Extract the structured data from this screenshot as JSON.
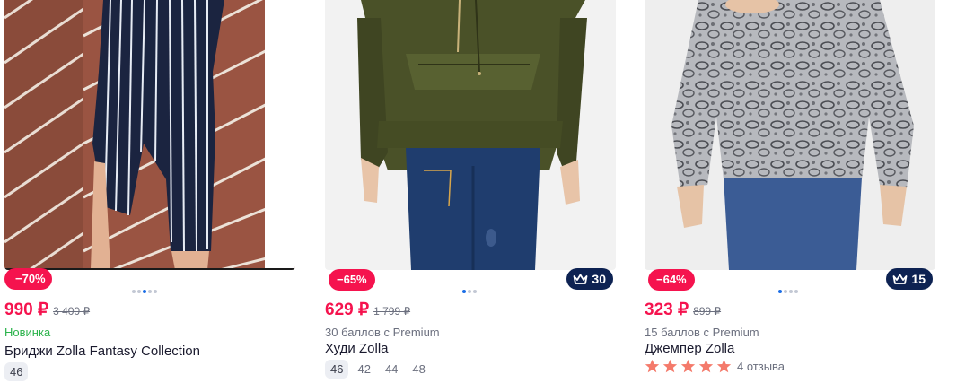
{
  "colors": {
    "accent_red": "#f5134e",
    "premium_navy": "#0d2252",
    "new_green": "#2bb34b",
    "star": "#f47a6b",
    "dot_active": "#1b6ee6"
  },
  "products": [
    {
      "discount": "−70%",
      "price": "990 ₽",
      "old_price": "3 400 ₽",
      "subtitle": "Новинка",
      "name": "Бриджи Zolla Fantasy Collection",
      "sizes": [
        "46"
      ],
      "image_icon": "striped-capri-trousers-photo",
      "carousel_dots": 5,
      "carousel_active": 3
    },
    {
      "discount": "−65%",
      "premium_points": "30",
      "price": "629 ₽",
      "old_price": "1 799 ₽",
      "subtitle": "30 баллов с Premium",
      "name": "Худи Zolla",
      "sizes": [
        "46",
        "42",
        "44",
        "48"
      ],
      "image_icon": "olive-hoodie-photo",
      "carousel_dots": 3,
      "carousel_active": 1
    },
    {
      "discount": "−64%",
      "premium_points": "15",
      "price": "323 ₽",
      "old_price": "899 ₽",
      "subtitle": "15 баллов с Premium",
      "name": "Джемпер Zolla",
      "rating": 5,
      "reviews": "4 отзыва",
      "image_icon": "snake-print-jumper-photo",
      "carousel_dots": 4,
      "carousel_active": 1
    }
  ]
}
